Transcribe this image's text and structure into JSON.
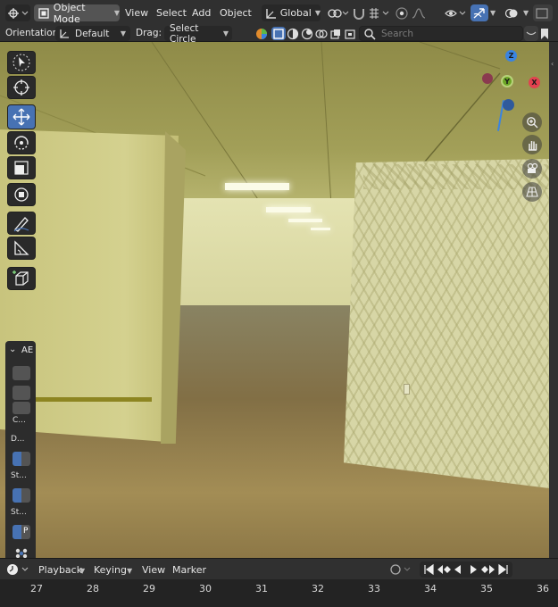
{
  "header": {
    "mode_label": "Object Mode",
    "menus": [
      "View",
      "Select",
      "Add",
      "Object"
    ],
    "transform_orientation": "Global"
  },
  "toolbar2": {
    "orientation_label": "Orientation:",
    "orientation_value": "Default",
    "drag_label": "Drag:",
    "drag_value": "Select Circle",
    "search_placeholder": "Search"
  },
  "viewport": {
    "gizmo": {
      "z": "Z",
      "y": "Y",
      "x": "X"
    }
  },
  "side_panel": {
    "tab_label": "AE",
    "labels": [
      "C...",
      "D...",
      "St...",
      "St...",
      "P"
    ]
  },
  "timeline": {
    "menus": [
      "Playback",
      "Keying",
      "View",
      "Marker"
    ],
    "frames": [
      "27",
      "28",
      "29",
      "30",
      "31",
      "32",
      "33",
      "34",
      "35",
      "36"
    ]
  },
  "colors": {
    "accent_blue": "#4772b3",
    "axis_x": "#e2414f",
    "axis_y": "#6ca626",
    "axis_z": "#3a84e0",
    "header_bg": "#303030"
  }
}
